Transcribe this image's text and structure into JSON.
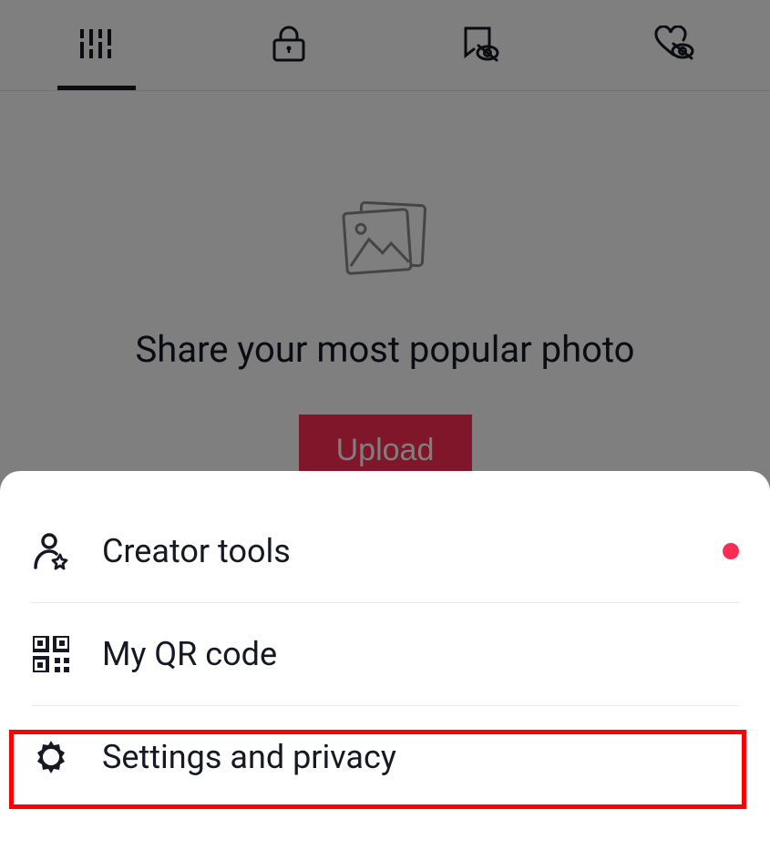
{
  "tabs": [
    {
      "name": "grid",
      "active": true
    },
    {
      "name": "private",
      "active": false
    },
    {
      "name": "repost",
      "active": false
    },
    {
      "name": "liked",
      "active": false
    }
  ],
  "empty_state": {
    "title": "Share your most popular photo",
    "button": "Upload"
  },
  "menu": {
    "items": [
      {
        "key": "creator",
        "label": "Creator tools",
        "has_dot": true
      },
      {
        "key": "qr",
        "label": "My QR code",
        "has_dot": false
      },
      {
        "key": "settings",
        "label": "Settings and privacy",
        "has_dot": false
      }
    ]
  }
}
